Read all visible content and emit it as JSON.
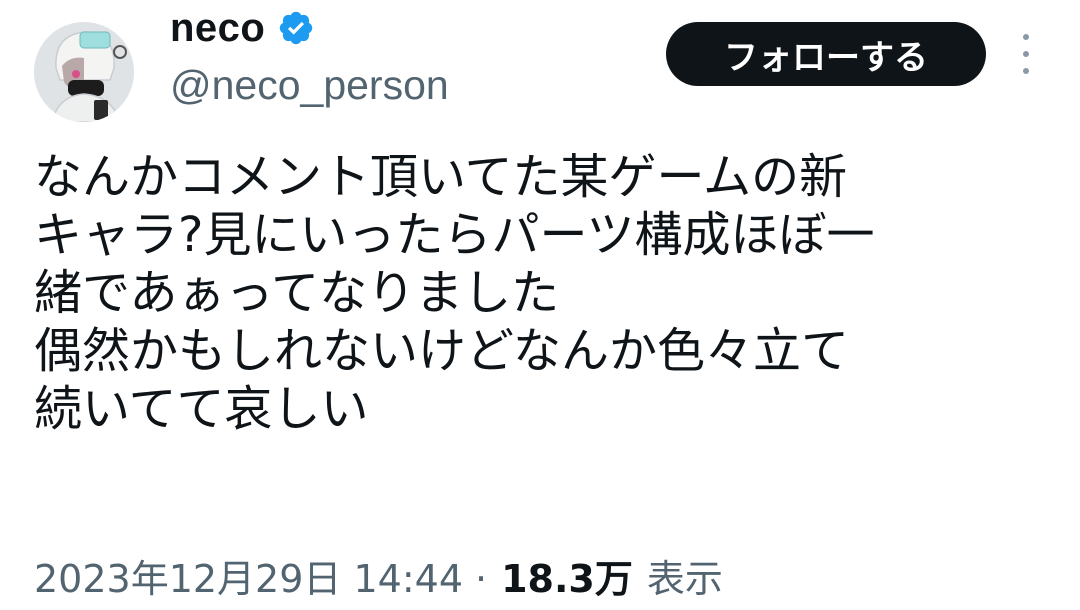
{
  "author": {
    "display_name": "neco",
    "handle": "@neco_person",
    "verified_icon": "verified-badge-icon",
    "badge_color": "#1d9bf0"
  },
  "actions": {
    "follow_label": "フォローする",
    "more_icon": "more-vertical-icon"
  },
  "tweet": {
    "lines": [
      "なんかコメント頂いてた某ゲームの新",
      "キャラ?見にいったらパーツ構成ほぼ一",
      "緒であぁってなりました",
      "偶然かもしれないけどなんか色々立て",
      "続いてて哀しい"
    ]
  },
  "meta": {
    "timestamp": "2023年12月29日 14:44",
    "separator": "·",
    "views_count": "18.3万",
    "views_label": "表示"
  },
  "colors": {
    "text": "#0f1419",
    "secondary": "#536471",
    "button_bg": "#0f1419"
  }
}
